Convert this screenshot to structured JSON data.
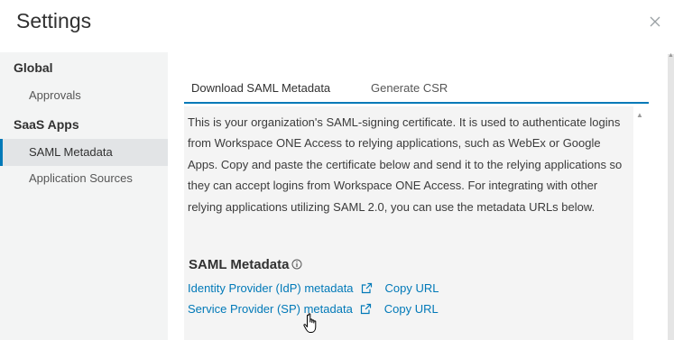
{
  "dialog": {
    "title": "Settings"
  },
  "sidebar": {
    "groups": [
      {
        "label": "Global",
        "items": [
          {
            "label": "Approvals",
            "active": false
          }
        ]
      },
      {
        "label": "SaaS Apps",
        "items": [
          {
            "label": "SAML Metadata",
            "active": true
          },
          {
            "label": "Application Sources",
            "active": false
          }
        ]
      }
    ]
  },
  "tabs": [
    {
      "label": "Download SAML Metadata",
      "active": true
    },
    {
      "label": "Generate CSR",
      "active": false
    }
  ],
  "content": {
    "description": "This is your organization's SAML-signing certificate. It is used to authenticate logins from Workspace ONE Access to relying applications, such as WebEx or Google Apps. Copy and paste the certificate below and send it to the relying applications so they can accept logins from Workspace ONE Access. For integrating with other relying applications utilizing SAML 2.0, you can use the metadata URLs below.",
    "metadata_heading": "SAML Metadata",
    "links": [
      {
        "label": "Identity Provider (IdP) metadata",
        "copy_label": "Copy URL"
      },
      {
        "label": "Service Provider (SP) metadata",
        "copy_label": "Copy URL"
      }
    ]
  },
  "colors": {
    "accent": "#0079b8",
    "sidebar_bg": "#f3f4f4",
    "sidebar_active_bg": "#e2e4e6",
    "content_bg": "#f4f4f4"
  },
  "icons": [
    "close-icon",
    "info-icon",
    "external-link-icon",
    "hand-pointer-cursor"
  ]
}
